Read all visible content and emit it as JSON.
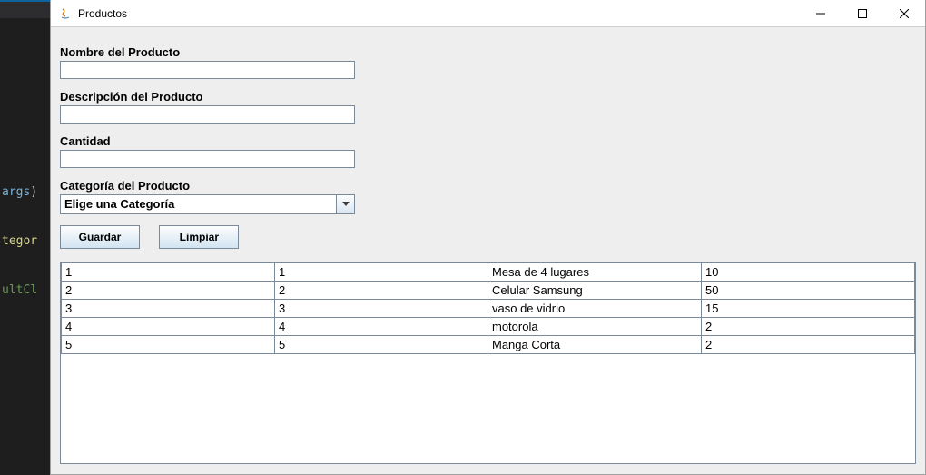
{
  "window": {
    "title": "Productos"
  },
  "code_snippet": {
    "line1a": "args",
    "line1b": ")",
    "line2": "tegor",
    "line3": "ultCl"
  },
  "form": {
    "nombre_label": "Nombre del Producto",
    "nombre_value": "",
    "descripcion_label": "Descripción del Producto",
    "descripcion_value": "",
    "cantidad_label": "Cantidad",
    "cantidad_value": "",
    "categoria_label": "Categoría del Producto",
    "categoria_selected": "Elige una Categoría"
  },
  "buttons": {
    "guardar": "Guardar",
    "limpiar": "Limpiar"
  },
  "table": {
    "rows": [
      {
        "c0": "1",
        "c1": "1",
        "c2": "Mesa de 4 lugares",
        "c3": "10"
      },
      {
        "c0": "2",
        "c1": "2",
        "c2": "Celular Samsung",
        "c3": "50"
      },
      {
        "c0": "3",
        "c1": "3",
        "c2": "vaso de vidrio",
        "c3": "15"
      },
      {
        "c0": "4",
        "c1": "4",
        "c2": "motorola",
        "c3": "2"
      },
      {
        "c0": "5",
        "c1": "5",
        "c2": "Manga Corta",
        "c3": "2"
      }
    ]
  }
}
